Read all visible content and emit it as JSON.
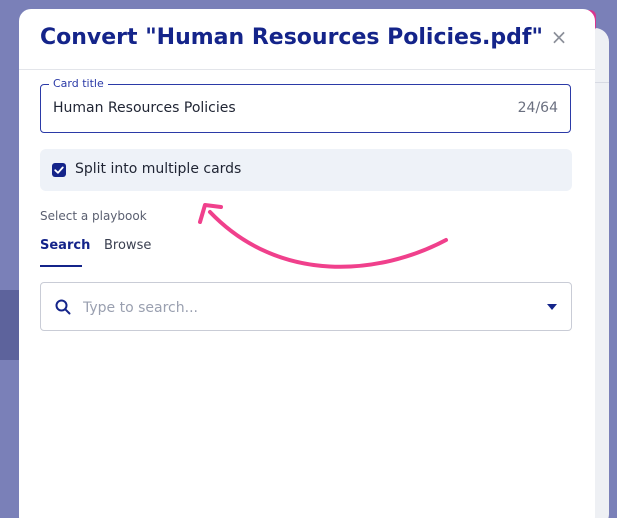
{
  "dialog": {
    "title": "Convert \"Human Resources Policies.pdf\"",
    "close_icon": "×"
  },
  "card_title": {
    "label": "Card title",
    "value": "Human Resources Policies",
    "count": "24/64"
  },
  "split": {
    "label": "Split into multiple cards",
    "checked": true
  },
  "playbook": {
    "label": "Select a playbook",
    "tabs": [
      {
        "label": "Search",
        "active": true
      },
      {
        "label": "Browse",
        "active": false
      }
    ],
    "search": {
      "placeholder": "Type to search..."
    }
  },
  "colors": {
    "primary": "#14248a",
    "annotation_arrow": "#f0408c",
    "backdrop": "#7a80b8"
  },
  "icons": {
    "close": "close-icon",
    "search": "search-icon",
    "dropdown": "chevron-down-icon",
    "checkbox": "checkmark-icon"
  }
}
